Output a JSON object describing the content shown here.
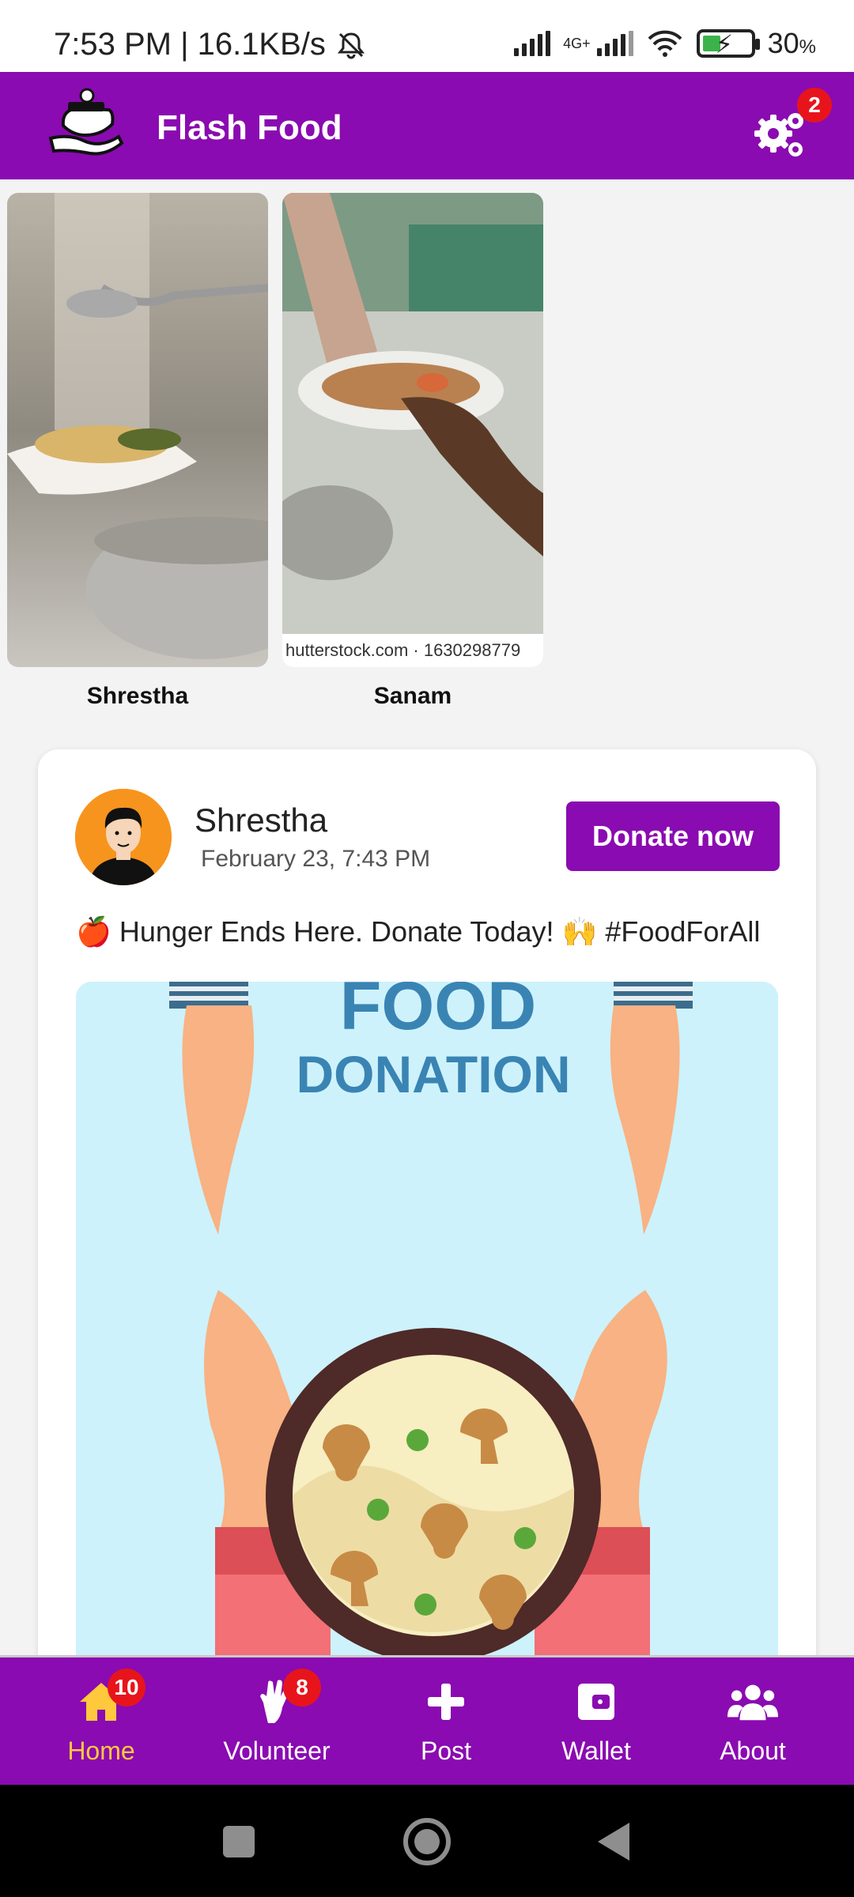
{
  "status_bar": {
    "time_speed": "7:53 PM | 16.1KB/s",
    "network_label": "4G+",
    "battery_percent": "30",
    "battery_unit": "%"
  },
  "header": {
    "title": "Flash Food",
    "settings_badge": "2"
  },
  "stories": [
    {
      "name": "Shrestha"
    },
    {
      "name": "Sanam",
      "watermark": "hutterstock.com · 1630298779"
    }
  ],
  "post": {
    "author": "Shrestha",
    "time": "February 23, 7:43 PM",
    "donate_label": "Donate now",
    "caption": "🍎 Hunger Ends Here. Donate Today! 🙌 #FoodForAll",
    "image_title_1": "FOOD",
    "image_title_2": "DONATION"
  },
  "bottom_nav": {
    "items": [
      {
        "label": "Home",
        "icon": "home-icon",
        "badge": "10",
        "active": true
      },
      {
        "label": "Volunteer",
        "icon": "volunteer-icon",
        "badge": "8"
      },
      {
        "label": "Post",
        "icon": "plus-icon"
      },
      {
        "label": "Wallet",
        "icon": "wallet-icon"
      },
      {
        "label": "About",
        "icon": "group-icon"
      }
    ]
  },
  "colors": {
    "brand": "#8a0bb1",
    "active_tab": "#ffc83d",
    "badge": "#e8141c"
  }
}
